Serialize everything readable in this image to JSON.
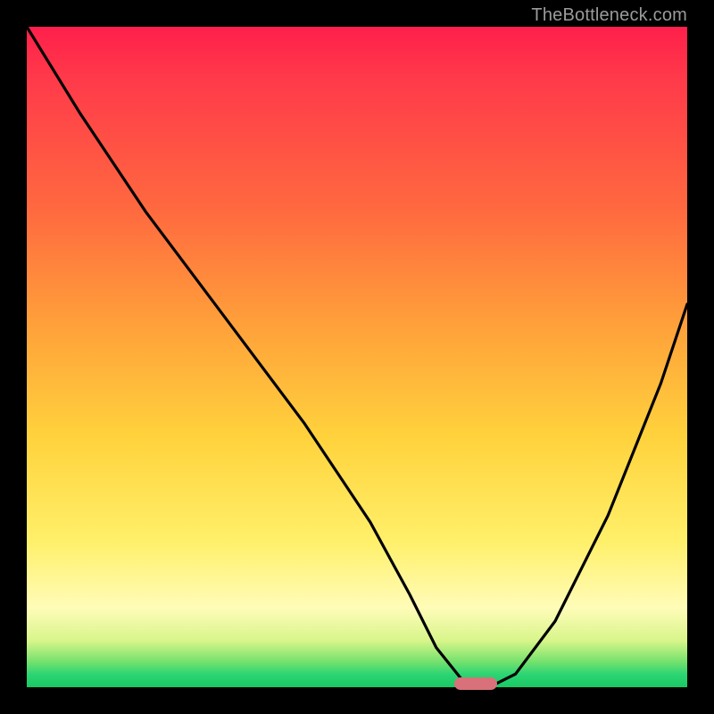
{
  "watermark": "TheBottleneck.com",
  "colors": {
    "frame_bg": "#000000",
    "curve_stroke": "#000000",
    "marker_fill": "#d9717a",
    "gradient_stops": [
      "#ff1f4b",
      "#ff3a4a",
      "#ff6a3f",
      "#ffa03a",
      "#ffd23c",
      "#fff06a",
      "#fffcb8",
      "#d7f58a",
      "#7ae26e",
      "#2ed573",
      "#18c964"
    ]
  },
  "chart_data": {
    "type": "line",
    "title": "",
    "xlabel": "",
    "ylabel": "",
    "xlim": [
      0,
      100
    ],
    "ylim": [
      0,
      100
    ],
    "series": [
      {
        "name": "bottleneck-curve",
        "x": [
          0,
          8,
          18,
          30,
          42,
          52,
          58,
          62,
          66,
          70,
          74,
          80,
          88,
          96,
          100
        ],
        "values": [
          100,
          87,
          72,
          56,
          40,
          25,
          14,
          6,
          1,
          0,
          2,
          10,
          26,
          46,
          58
        ]
      }
    ],
    "annotations": [
      {
        "name": "sweet-spot-marker",
        "x": 68,
        "y": 0.5,
        "shape": "pill",
        "color": "#d9717a"
      }
    ],
    "grid": false,
    "legend": false
  }
}
